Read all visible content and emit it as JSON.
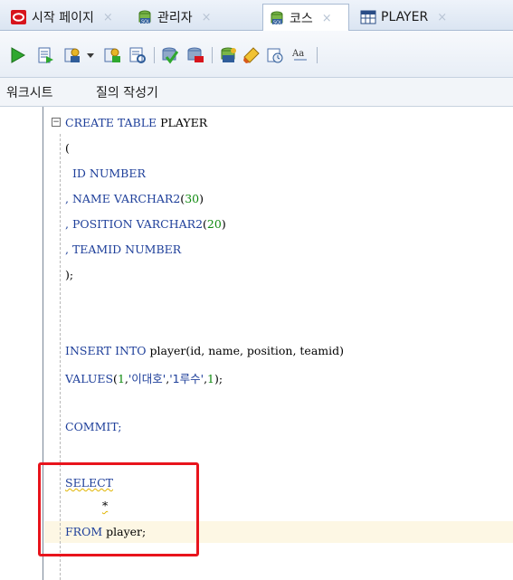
{
  "tabs": [
    {
      "label": "시작 페이지",
      "icon": "oracle-start-icon",
      "active": false
    },
    {
      "label": "관리자",
      "icon": "db-connection-icon",
      "active": false
    },
    {
      "label": "코스",
      "icon": "sql-worksheet-icon",
      "active": true
    },
    {
      "label": "PLAYER",
      "icon": "table-grid-icon",
      "active": false
    }
  ],
  "tab_close_glyph": "×",
  "toolbar": {
    "icons": [
      "run-statement-icon",
      "run-script-icon",
      "autotrace-icon",
      "dropdown-arrow-icon",
      "explain-plan-icon",
      "sql-tuning-icon",
      "commit-icon",
      "rollback-icon",
      "unshared-sql-icon",
      "clear-icon",
      "sql-history-icon",
      "format-case-icon"
    ]
  },
  "subtabs": {
    "worksheet": "워크시트",
    "query_builder": "질의 작성기"
  },
  "editor": {
    "fold_glyph": "−",
    "lines": {
      "l1a": "CREATE TABLE",
      "l1b": " PLAYER",
      "l2": "(",
      "l3a": "  ID ",
      "l3b": "NUMBER",
      "l4a": ", NAME ",
      "l4b": "VARCHAR2",
      "l4c": "(",
      "l4d": "30",
      "l4e": ")",
      "l5a": ", POSITION ",
      "l5b": "VARCHAR2",
      "l5c": "(",
      "l5d": "20",
      "l5e": ")",
      "l6a": ", TEAMID ",
      "l6b": "NUMBER",
      "l7": ");",
      "l8a": "INSERT INTO",
      "l8b": " player(id, name, position, teamid)",
      "l9a": "VALUES",
      "l9b": "(",
      "l9c": "1",
      "l9d": ",",
      "l9e": "'이대호'",
      "l9f": ",",
      "l9g": "'1루수'",
      "l9h": ",",
      "l9i": "1",
      "l9j": ");",
      "l10": "COMMIT;",
      "l11": "SELECT",
      "l12": "*",
      "l13a": "FROM",
      "l13b": " player;"
    }
  },
  "colors": {
    "keyword": "#1e3f9a",
    "number": "#0f8a0f",
    "highlight_box": "#e8141c",
    "current_line": "#fdf7e4"
  }
}
